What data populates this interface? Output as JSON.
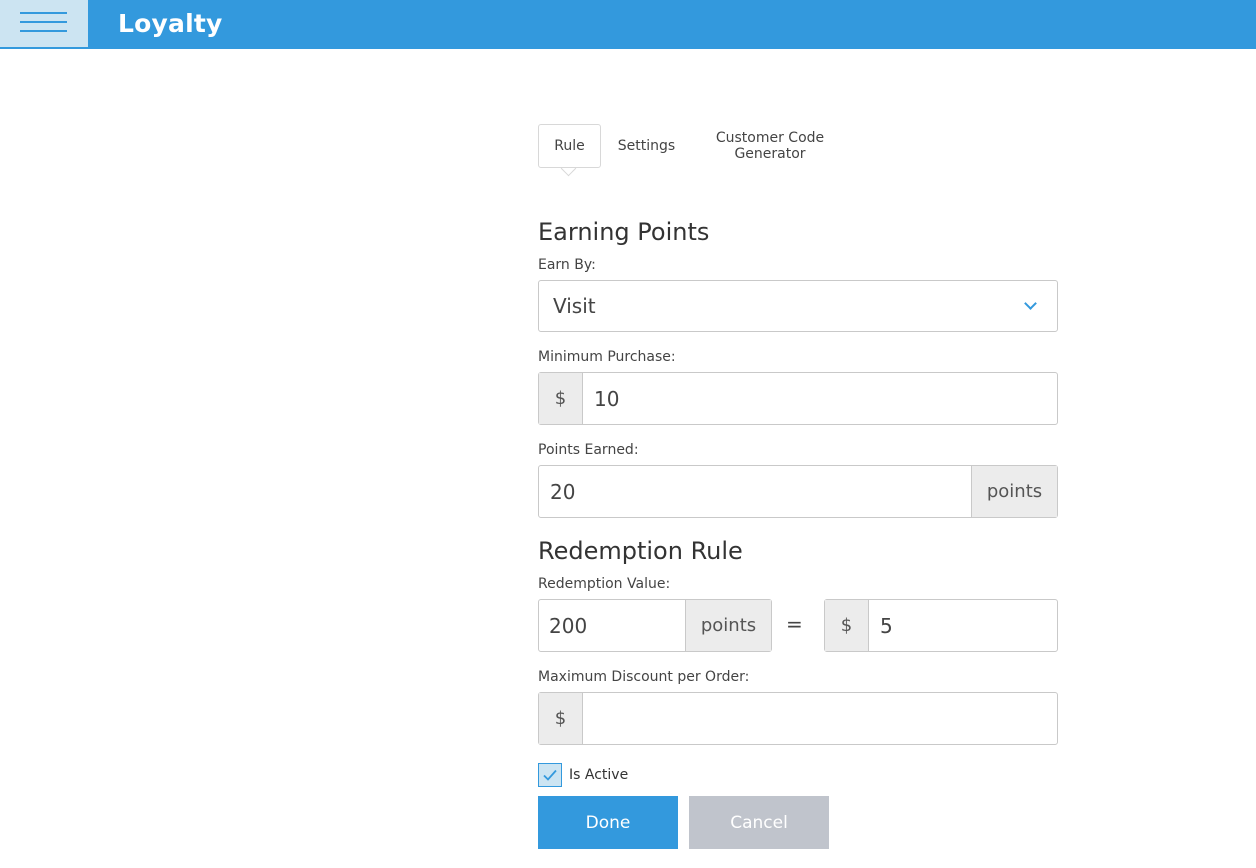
{
  "app": {
    "title": "Loyalty"
  },
  "tabs": [
    {
      "label": "Rule"
    },
    {
      "label": "Settings"
    },
    {
      "label": "Customer Code Generator"
    }
  ],
  "earning": {
    "title": "Earning Points",
    "earn_by_label": "Earn By:",
    "earn_by_value": "Visit",
    "min_purchase_label": "Minimum Purchase:",
    "min_purchase_prefix": "$",
    "min_purchase_value": "10",
    "points_earned_label": "Points Earned:",
    "points_earned_value": "20",
    "points_earned_suffix": "points"
  },
  "redemption": {
    "title": "Redemption Rule",
    "value_label": "Redemption Value:",
    "points_value": "200",
    "points_suffix": "points",
    "equals": "=",
    "dollar_prefix": "$",
    "dollar_value": "5",
    "max_discount_label": "Maximum Discount per Order:",
    "max_discount_prefix": "$",
    "max_discount_value": ""
  },
  "is_active": {
    "label": "Is Active",
    "checked": true
  },
  "buttons": {
    "done": "Done",
    "cancel": "Cancel"
  },
  "icons": {
    "menu": "hamburger-menu-icon",
    "dropdown": "chevron-down-icon",
    "check": "checkmark-icon"
  },
  "colors": {
    "primary": "#3399dd",
    "menu_bg": "#cce4f2",
    "cancel": "#c0c4cc"
  }
}
